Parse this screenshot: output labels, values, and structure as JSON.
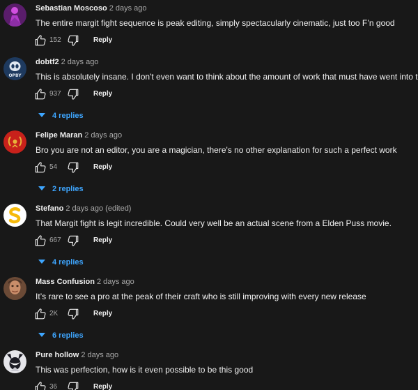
{
  "colors": {
    "background": "#181818",
    "text": "#f1f1f1",
    "secondary": "#aaaaaa",
    "link": "#3ea6ff"
  },
  "comments": [
    {
      "author": "Sebastian Moscoso",
      "time": "2 days ago",
      "text": "The entire margit fight sequence is peak editing, simply spectacularly cinematic, just too F’n good",
      "likes": "152",
      "reply_label": "Reply",
      "replies": "",
      "avatar_icon": "purple-figure-avatar"
    },
    {
      "author": "dobtf2",
      "time": "2 days ago",
      "text": "This is absolutely insane. I don't even want to think about the amount of work that must have went into this.",
      "likes": "937",
      "reply_label": "Reply",
      "replies": "4 replies",
      "avatar_icon": "alien-logo-avatar",
      "avatar_text": "OPBY"
    },
    {
      "author": "Felipe Maran",
      "time": "2 days ago",
      "text": "Bro you are not an editor, you are a magician, there's no other explanation for such a perfect work",
      "likes": "54",
      "reply_label": "Reply",
      "replies": "2 replies",
      "avatar_icon": "laurel-wreath-avatar"
    },
    {
      "author": "Stefano",
      "time": "2 days ago",
      "edited": "(edited)",
      "text": "That Margit fight is legit incredible. Could very well be an actual scene from a Elden Puss movie.",
      "likes": "667",
      "reply_label": "Reply",
      "replies": "4 replies",
      "avatar_icon": "yellow-s-logo-avatar"
    },
    {
      "author": "Mass Confusion",
      "time": "2 days ago",
      "text": "It’s rare to see a pro at the peak of their craft who is still improving  with every new release",
      "likes": "2K",
      "reply_label": "Reply",
      "replies": "6 replies",
      "avatar_icon": "portrait-avatar"
    },
    {
      "author": "Pure hollow",
      "time": "2 days ago",
      "text": "This was perfection, how is it even possible to be this good",
      "likes": "36",
      "reply_label": "Reply",
      "replies": "",
      "avatar_icon": "hollow-knight-avatar"
    }
  ]
}
